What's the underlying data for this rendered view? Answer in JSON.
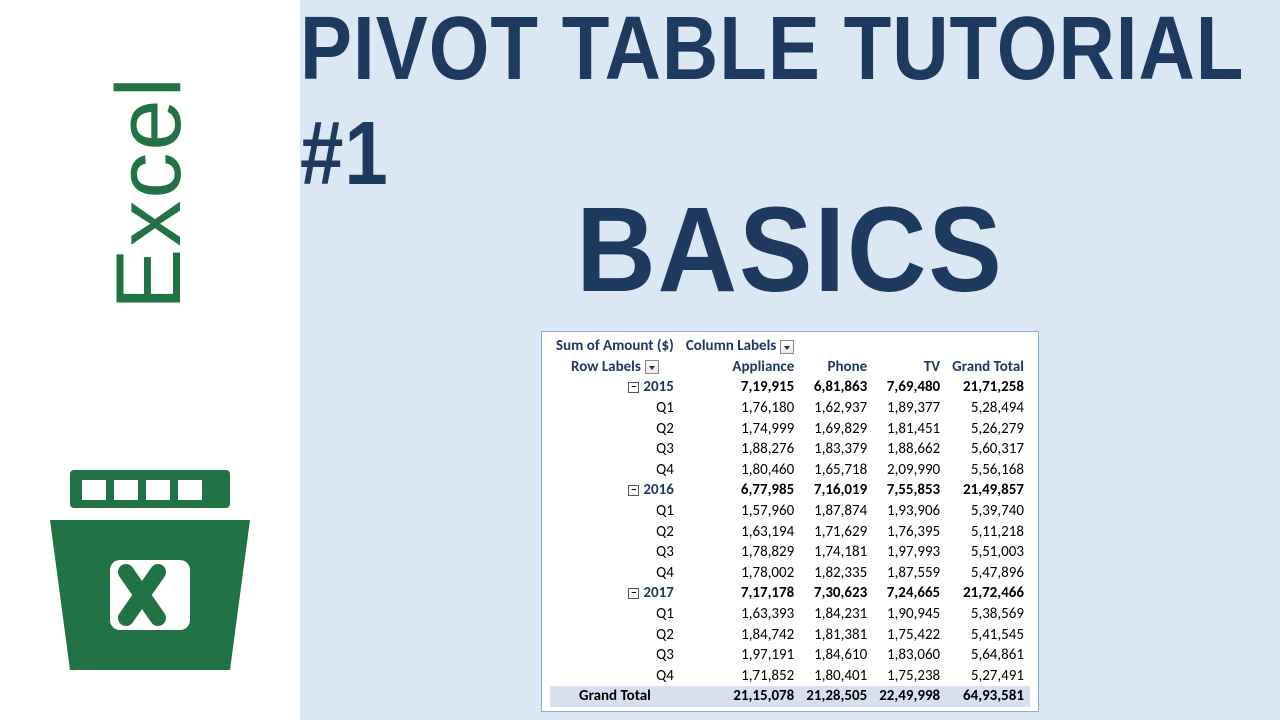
{
  "left": {
    "app_label": "Excel"
  },
  "title": {
    "line1": "PIVOT TABLE TUTORIAL #1",
    "line2": "BASICS"
  },
  "pivot": {
    "measure": "Sum of Amount ($)",
    "column_labels_caption": "Column Labels",
    "row_labels_caption": "Row Labels",
    "columns": [
      "Appliance",
      "Phone",
      "TV",
      "Grand Total"
    ],
    "groups": [
      {
        "year": "2015",
        "totals": [
          "7,19,915",
          "6,81,863",
          "7,69,480",
          "21,71,258"
        ],
        "rows": [
          {
            "label": "Q1",
            "vals": [
              "1,76,180",
              "1,62,937",
              "1,89,377",
              "5,28,494"
            ]
          },
          {
            "label": "Q2",
            "vals": [
              "1,74,999",
              "1,69,829",
              "1,81,451",
              "5,26,279"
            ]
          },
          {
            "label": "Q3",
            "vals": [
              "1,88,276",
              "1,83,379",
              "1,88,662",
              "5,60,317"
            ]
          },
          {
            "label": "Q4",
            "vals": [
              "1,80,460",
              "1,65,718",
              "2,09,990",
              "5,56,168"
            ]
          }
        ]
      },
      {
        "year": "2016",
        "totals": [
          "6,77,985",
          "7,16,019",
          "7,55,853",
          "21,49,857"
        ],
        "rows": [
          {
            "label": "Q1",
            "vals": [
              "1,57,960",
              "1,87,874",
              "1,93,906",
              "5,39,740"
            ]
          },
          {
            "label": "Q2",
            "vals": [
              "1,63,194",
              "1,71,629",
              "1,76,395",
              "5,11,218"
            ]
          },
          {
            "label": "Q3",
            "vals": [
              "1,78,829",
              "1,74,181",
              "1,97,993",
              "5,51,003"
            ]
          },
          {
            "label": "Q4",
            "vals": [
              "1,78,002",
              "1,82,335",
              "1,87,559",
              "5,47,896"
            ]
          }
        ]
      },
      {
        "year": "2017",
        "totals": [
          "7,17,178",
          "7,30,623",
          "7,24,665",
          "21,72,466"
        ],
        "rows": [
          {
            "label": "Q1",
            "vals": [
              "1,63,393",
              "1,84,231",
              "1,90,945",
              "5,38,569"
            ]
          },
          {
            "label": "Q2",
            "vals": [
              "1,84,742",
              "1,81,381",
              "1,75,422",
              "5,41,545"
            ]
          },
          {
            "label": "Q3",
            "vals": [
              "1,97,191",
              "1,84,610",
              "1,83,060",
              "5,64,861"
            ]
          },
          {
            "label": "Q4",
            "vals": [
              "1,71,852",
              "1,80,401",
              "1,75,238",
              "5,27,491"
            ]
          }
        ]
      }
    ],
    "grand_total_label": "Grand Total",
    "grand_totals": [
      "21,15,078",
      "21,28,505",
      "22,49,998",
      "64,93,581"
    ]
  }
}
